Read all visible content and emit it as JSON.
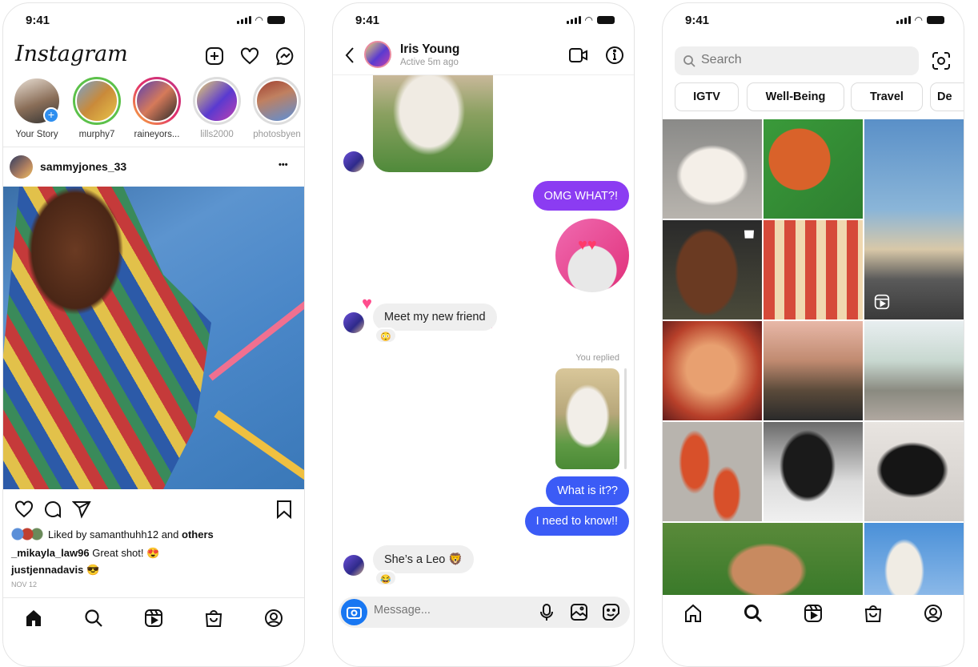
{
  "status_bar": {
    "time": "9:41"
  },
  "feed": {
    "logo": "Instagram",
    "stories": [
      {
        "label": "Your Story"
      },
      {
        "label": "murphy7"
      },
      {
        "label": "raineyors..."
      },
      {
        "label": "lills2000"
      },
      {
        "label": "photosbyen"
      }
    ],
    "post": {
      "username": "sammyjones_33",
      "more": "•••",
      "liked_by_prefix": "Liked by",
      "liked_by_user": "samanthuhh12",
      "liked_by_and": "and",
      "liked_by_others": "others",
      "comments": [
        {
          "user": "_mikayla_law96",
          "text": "Great shot! 😍"
        },
        {
          "user": "justjennadavis",
          "text": "😎"
        }
      ],
      "date": "NOV 12"
    }
  },
  "dm": {
    "contact_name": "Iris Young",
    "contact_status": "Active 5m ago",
    "messages": [
      {
        "from": "me",
        "text": "OMG WHAT?!"
      },
      {
        "from": "them",
        "text": "Meet my new friend",
        "reaction": "😳"
      },
      {
        "from": "me",
        "text": "What is it??"
      },
      {
        "from": "me",
        "text": "I need to know!!"
      },
      {
        "from": "them",
        "text": "She’s a Leo 🦁",
        "reaction": "😂"
      }
    ],
    "replied_label": "You replied",
    "composer_placeholder": "Message...",
    "colors": {
      "purple": "#8b3cf2",
      "blue": "#3b5bf6"
    }
  },
  "explore": {
    "search_placeholder": "Search",
    "chips": [
      "IGTV",
      "Well-Being",
      "Travel",
      "De"
    ]
  }
}
